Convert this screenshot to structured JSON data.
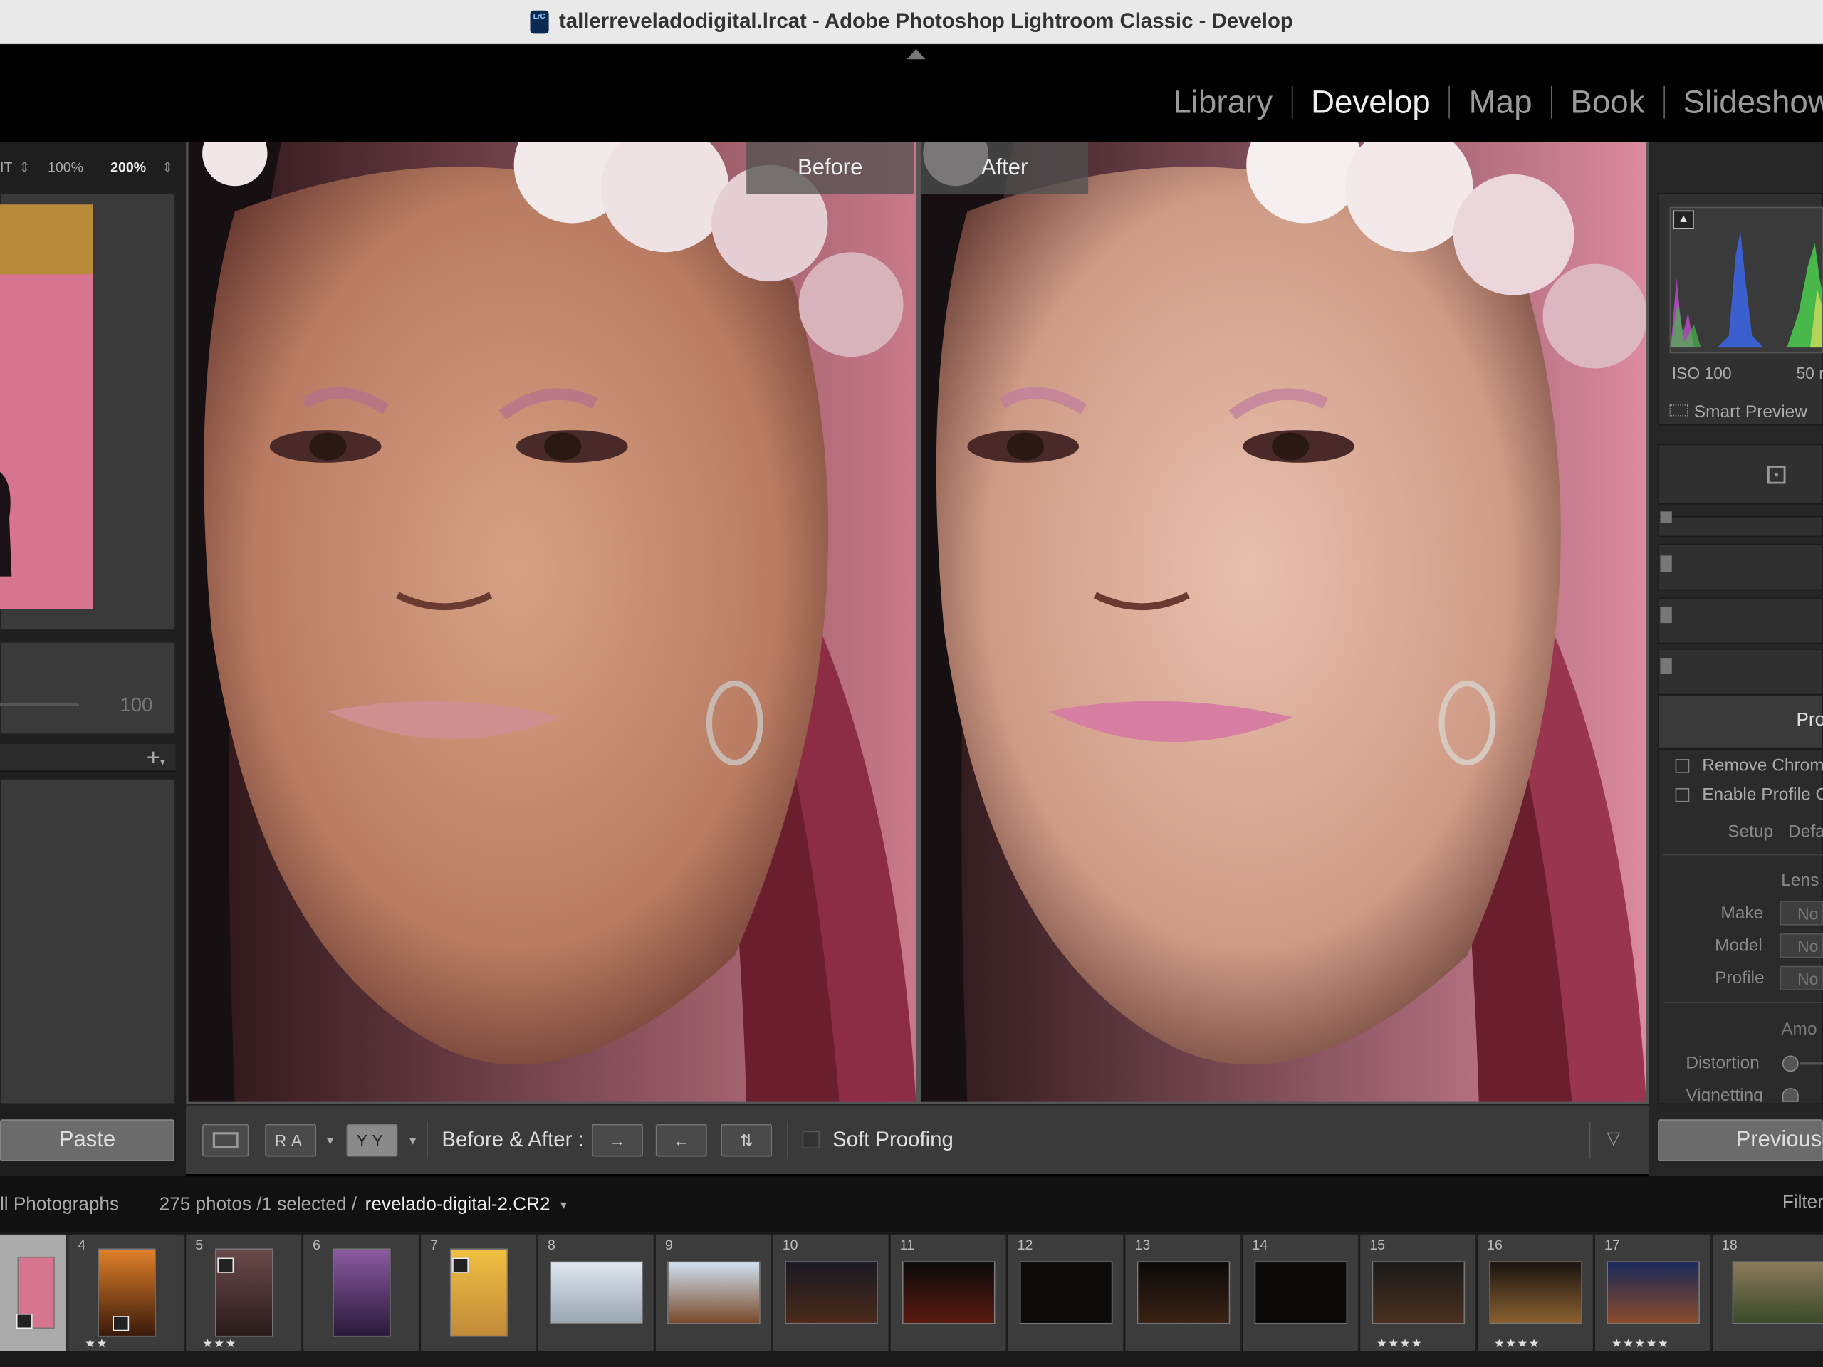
{
  "window": {
    "title": "tallerreveladodigital.lrcat - Adobe Photoshop Lightroom Classic - Develop",
    "app_icon": "LrC"
  },
  "modules": [
    {
      "label": "Library",
      "active": false
    },
    {
      "label": "Develop",
      "active": true
    },
    {
      "label": "Map",
      "active": false
    },
    {
      "label": "Book",
      "active": false
    },
    {
      "label": "Slideshow",
      "active": false
    }
  ],
  "navigator": {
    "fit": "IT",
    "zoom_100": "100%",
    "zoom_200": "200%"
  },
  "left_panel": {
    "value": "100",
    "add_icon": "plus-icon",
    "paste_label": "Paste"
  },
  "view": {
    "before_label": "Before",
    "after_label": "After",
    "before_after_label": "Before & After :",
    "soft_proofing_label": "Soft Proofing",
    "soft_proofing_checked": false
  },
  "right_panel": {
    "iso": "ISO 100",
    "focal": "50 r",
    "smart_preview": "Smart Preview",
    "panel_header": "Pro",
    "remove_chrom": "Remove Chrom",
    "enable_profile": "Enable Profile C",
    "setup_label": "Setup",
    "setup_value": "Defa",
    "lens_label": "Lens",
    "make_label": "Make",
    "model_label": "Model",
    "profile_label": "Profile",
    "none_value": "No",
    "amount_label": "Amo",
    "distortion_label": "Distortion",
    "vignetting_label": "Vignetting",
    "previous_label": "Previous"
  },
  "filmstrip_bar": {
    "source": "ll Photographs",
    "count": "275 photos /1 selected /",
    "filename": "revelado-digital-2.CR2",
    "filter": "Filter"
  },
  "filmstrip": [
    {
      "num": "",
      "stars": ""
    },
    {
      "num": "4",
      "stars": "★★"
    },
    {
      "num": "5",
      "stars": "★★★"
    },
    {
      "num": "6",
      "stars": ""
    },
    {
      "num": "7",
      "stars": ""
    },
    {
      "num": "8",
      "stars": ""
    },
    {
      "num": "9",
      "stars": ""
    },
    {
      "num": "10",
      "stars": ""
    },
    {
      "num": "11",
      "stars": ""
    },
    {
      "num": "12",
      "stars": ""
    },
    {
      "num": "13",
      "stars": ""
    },
    {
      "num": "14",
      "stars": ""
    },
    {
      "num": "15",
      "stars": "★★★★"
    },
    {
      "num": "16",
      "stars": "★★★★"
    },
    {
      "num": "17",
      "stars": "★★★★★"
    },
    {
      "num": "18",
      "stars": ""
    }
  ],
  "colors": {
    "accent_backdrop": "#d7748f",
    "panel": "#3a3a3a",
    "histogram_blue": "#3c5fd0",
    "histogram_green": "#48b84a"
  }
}
